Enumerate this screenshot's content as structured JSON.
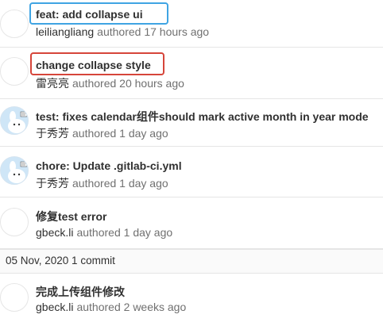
{
  "commits": [
    {
      "title": "feat: add collapse ui",
      "author": "leiliangliang",
      "action": "authored",
      "time": "17 hours ago"
    },
    {
      "title": "change collapse style",
      "author": "雷亮亮",
      "action": "authored",
      "time": "20 hours ago"
    },
    {
      "title": "test: fixes calendar组件should mark active month in year mode",
      "author": "于秀芳",
      "action": "authored",
      "time": "1 day ago"
    },
    {
      "title": "chore: Update .gitlab-ci.yml",
      "author": "于秀芳",
      "action": "authored",
      "time": "1 day ago"
    },
    {
      "title": "修复test error",
      "author": "gbeck.li",
      "action": "authored",
      "time": "1 day ago"
    },
    {
      "title": "完成上传组件修改",
      "author": "gbeck.li",
      "action": "authored",
      "time": "2 weeks ago"
    }
  ],
  "day_header": {
    "label": "05 Nov, 2020 1 commit"
  },
  "highlight_colors": {
    "blue": "#3fa4e3",
    "red": "#d6453a"
  }
}
